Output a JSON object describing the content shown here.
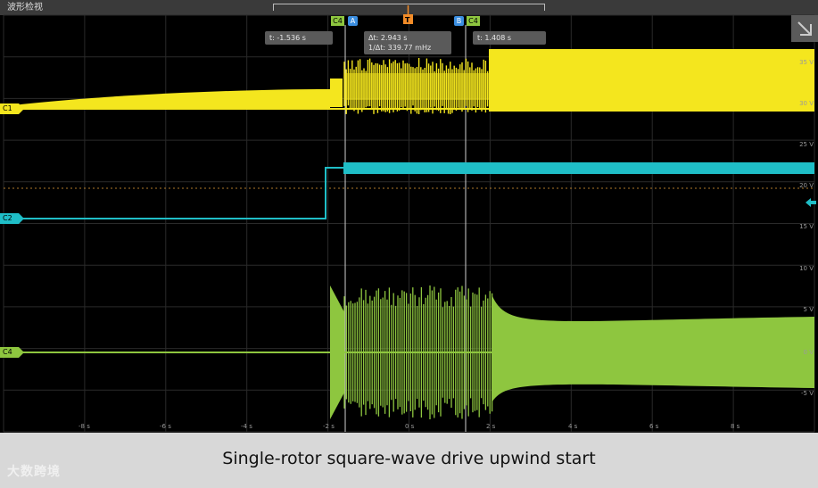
{
  "window": {
    "title": "波形检视"
  },
  "channels": [
    {
      "id": "C1",
      "color": "#f4e61e"
    },
    {
      "id": "C2",
      "color": "#1fbec7"
    },
    {
      "id": "C4",
      "color": "#8ec63f"
    }
  ],
  "cursors": {
    "tag_c4": "C4",
    "a": {
      "tag": "A",
      "readout": "t: -1.536 s"
    },
    "b": {
      "tag": "B",
      "readout": "t: 1.408 s"
    },
    "delta": {
      "dt": "Δt: 2.943 s",
      "inv": "1/Δt: 339.77 mHz"
    }
  },
  "trigger": {
    "label": "T"
  },
  "right_axis": [
    "35 V",
    "30 V",
    "25 V",
    "20 V",
    "15 V",
    "10 V",
    "5 V",
    "0 V",
    "-5 V"
  ],
  "time_axis": [
    "-8 s",
    "-6 s",
    "-4 s",
    "-2 s",
    "0 s",
    "2 s",
    "4 s",
    "6 s",
    "8 s"
  ],
  "caption": "Single-rotor square-wave drive upwind start",
  "logo": "大数跨境"
}
